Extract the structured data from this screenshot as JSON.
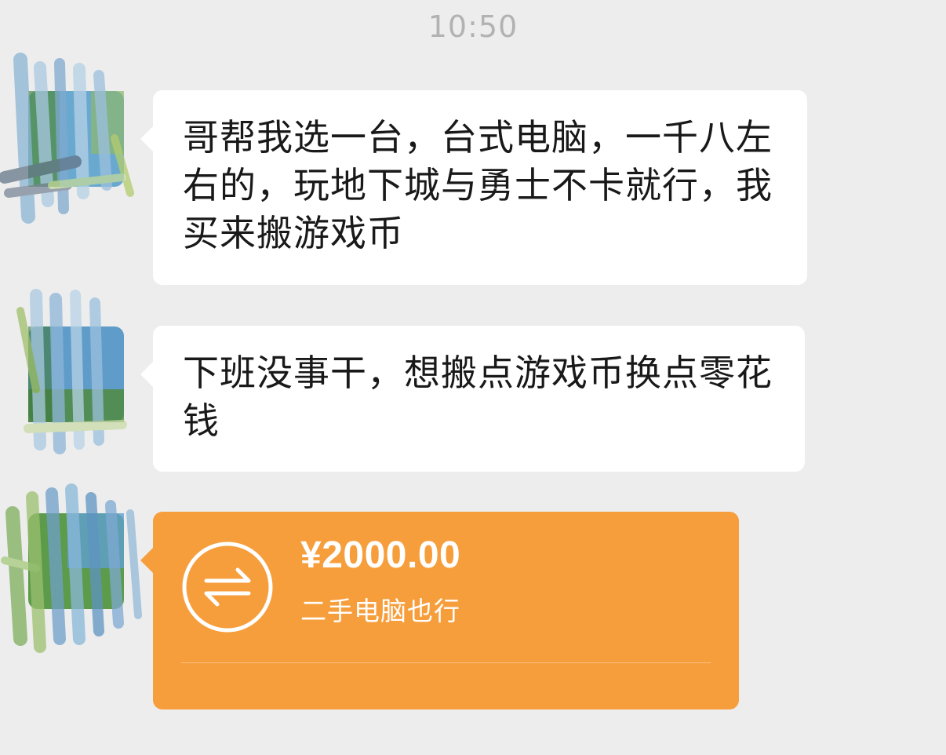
{
  "header": {
    "timestamp": "10:50"
  },
  "messages": [
    {
      "type": "text",
      "text": "哥帮我选一台，台式电脑，一千八左右的，玩地下城与勇士不卡就行，我买来搬游戏币"
    },
    {
      "type": "text",
      "text": "下班没事干，想搬点游戏币换点零花钱"
    },
    {
      "type": "transfer",
      "amount": "¥2000.00",
      "note": "二手电脑也行",
      "icon": "transfer-arrows-icon",
      "color": "#f79e3c"
    }
  ],
  "colors": {
    "background": "#ededed",
    "bubble": "#ffffff",
    "transfer": "#f79e3c",
    "timestamp": "#b2b2b2"
  }
}
